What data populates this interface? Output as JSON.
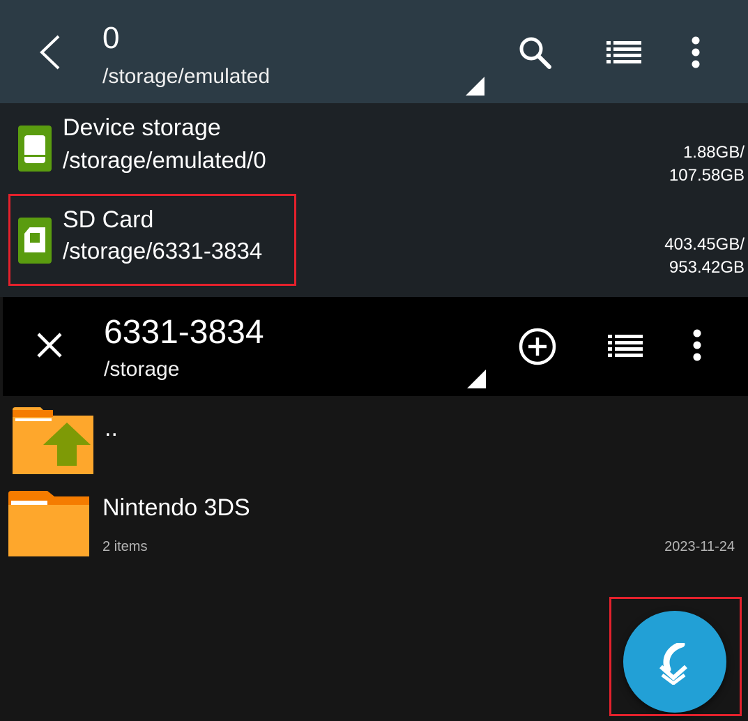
{
  "top_bar": {
    "title": "0",
    "path": "/storage/emulated",
    "icons": [
      "back-icon",
      "search-icon",
      "list-view-icon",
      "more-vert-icon"
    ]
  },
  "storages": [
    {
      "name": "Device storage",
      "path": "/storage/emulated/0",
      "size_used": "1.88GB/",
      "size_total": "107.58GB",
      "icon": "phone-storage-icon"
    },
    {
      "name": "SD Card",
      "path": "/storage/6331-3834",
      "size_used": "403.45GB/",
      "size_total": "953.42GB",
      "icon": "sd-card-icon"
    }
  ],
  "second_bar": {
    "title": "6331-3834",
    "path": "/storage",
    "icons": [
      "close-icon",
      "add-circle-icon",
      "list-view-icon",
      "more-vert-icon"
    ]
  },
  "files": [
    {
      "name": "..",
      "icon": "folder-up-icon"
    },
    {
      "name": "Nintendo 3DS",
      "meta": "2 items",
      "date": "2023-11-24",
      "icon": "folder-icon"
    }
  ],
  "fab": {
    "icon": "download-arrow-icon"
  },
  "colors": {
    "top_bar": "#2c3b45",
    "storage_panel": "#1d2226",
    "second_bar": "#000000",
    "file_area": "#161616",
    "drive_icon": "#5a9c0f",
    "folder": "#fea72c",
    "folder_tab": "#f57c00",
    "up_arrow": "#7e9a06",
    "fab": "#22a0d6",
    "highlight": "#e4212c"
  }
}
